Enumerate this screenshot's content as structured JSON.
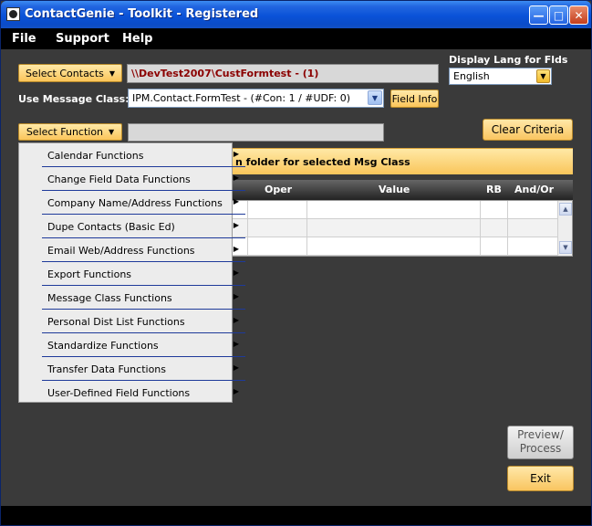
{
  "window": {
    "title": "ContactGenie - Toolkit - Registered"
  },
  "menu": [
    "File",
    "Support",
    "Help"
  ],
  "top": {
    "select_contacts_label": "Select Contacts",
    "contacts_path": "\\\\DevTest2007\\CustFormtest - (1)",
    "display_lang_label": "Display Lang for Flds",
    "display_lang_value": "English",
    "message_class_label": "Use Message Class:",
    "message_class_value": "IPM.Contact.FormTest - (#Con: 1 / #UDF: 0)",
    "field_info_label": "Field Info",
    "select_function_label": "Select Function",
    "function_value": "",
    "clear_criteria_label": "Clear Criteria"
  },
  "criteria": {
    "banner_text": "n folder for selected Msg Class",
    "columns": [
      "Oper",
      "Value",
      "RB",
      "And/Or"
    ]
  },
  "function_menu": [
    "Calendar Functions",
    "Change Field Data Functions",
    "Company Name/Address Functions",
    "Dupe Contacts (Basic Ed)",
    "Email Web/Address Functions",
    "Export Functions",
    "Message Class Functions",
    "Personal Dist List Functions",
    "Standardize Functions",
    "Transfer Data Functions",
    "User-Defined Field Functions"
  ],
  "bottom": {
    "preview_line1": "Preview/",
    "preview_line2": "Process",
    "exit_label": "Exit"
  },
  "colors": {
    "accent_orange": "#fbc55a",
    "path_text": "#8b0000",
    "menu_underline": "#1e3a9a"
  }
}
